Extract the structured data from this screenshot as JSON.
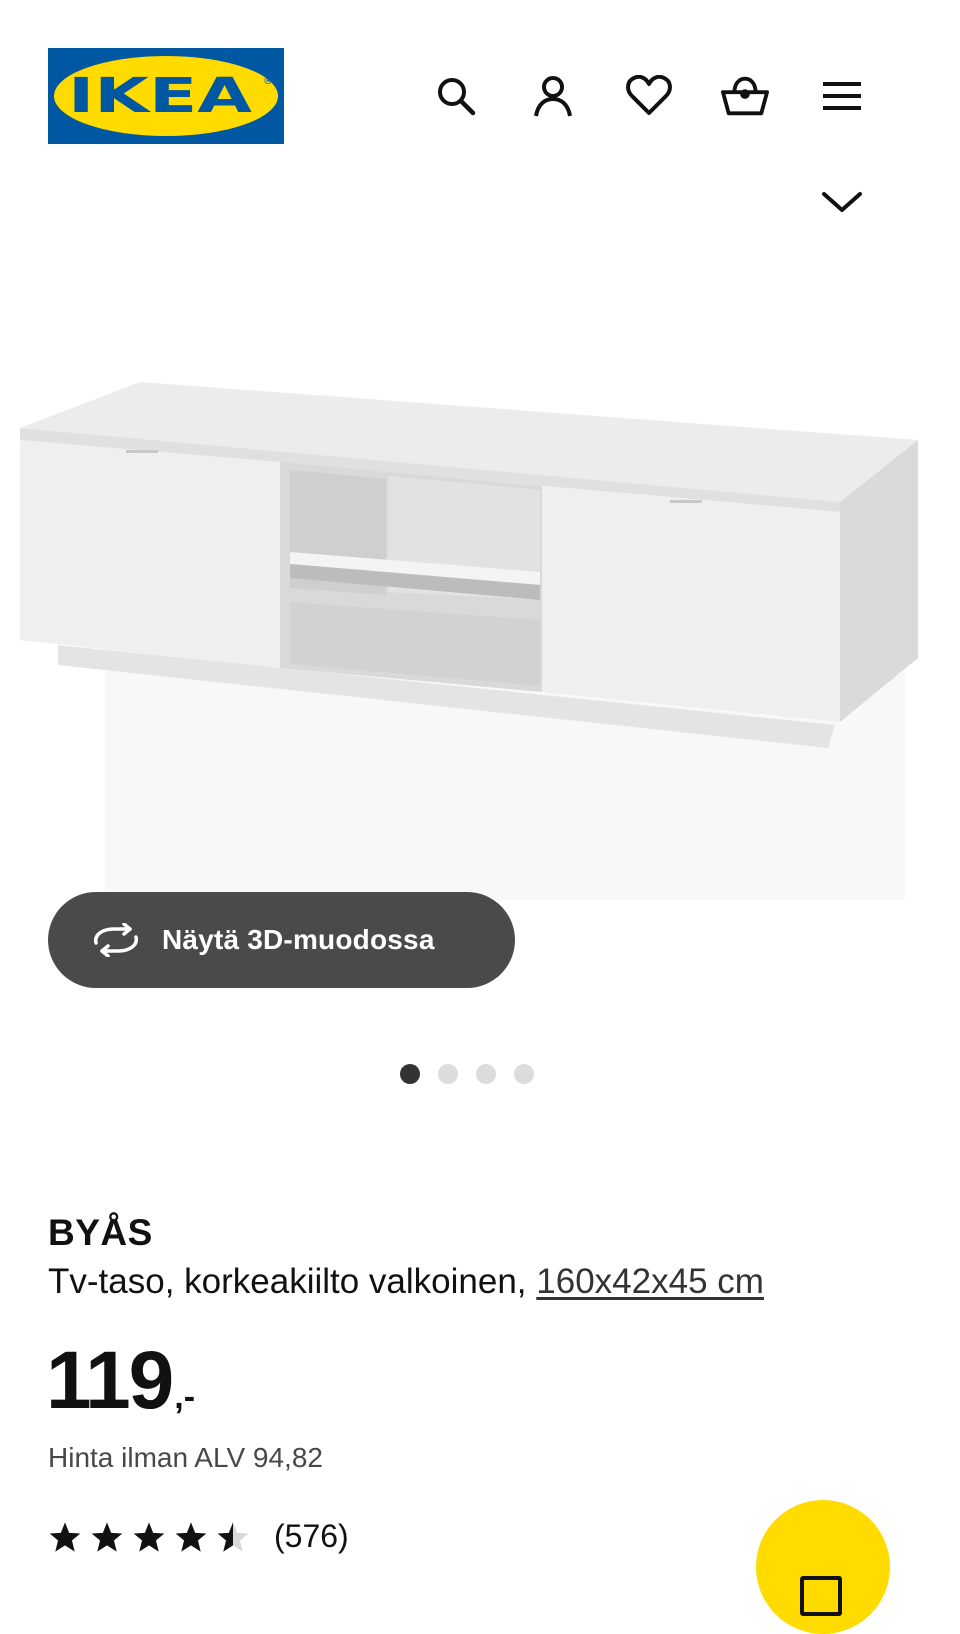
{
  "brand": {
    "name": "IKEA",
    "colors": {
      "blue": "#0058a3",
      "yellow": "#ffdb00"
    }
  },
  "header": {
    "icons": [
      "search-icon",
      "user-icon",
      "heart-icon",
      "basket-icon",
      "menu-icon",
      "chevron-down-icon"
    ]
  },
  "gallery": {
    "view_3d_label": "Näytä 3D-muodossa",
    "slide_count": 4,
    "active_slide": 1
  },
  "product": {
    "name": "BYÅS",
    "description": "Tv-taso, korkeakiilto valkoinen,",
    "dimensions": "160x42x45 cm",
    "price": "119",
    "price_suffix": ",-",
    "price_excl_vat": "Hinta ilman ALV 94,82",
    "rating": 4.5,
    "rating_max": 5,
    "review_count": "(576)"
  }
}
